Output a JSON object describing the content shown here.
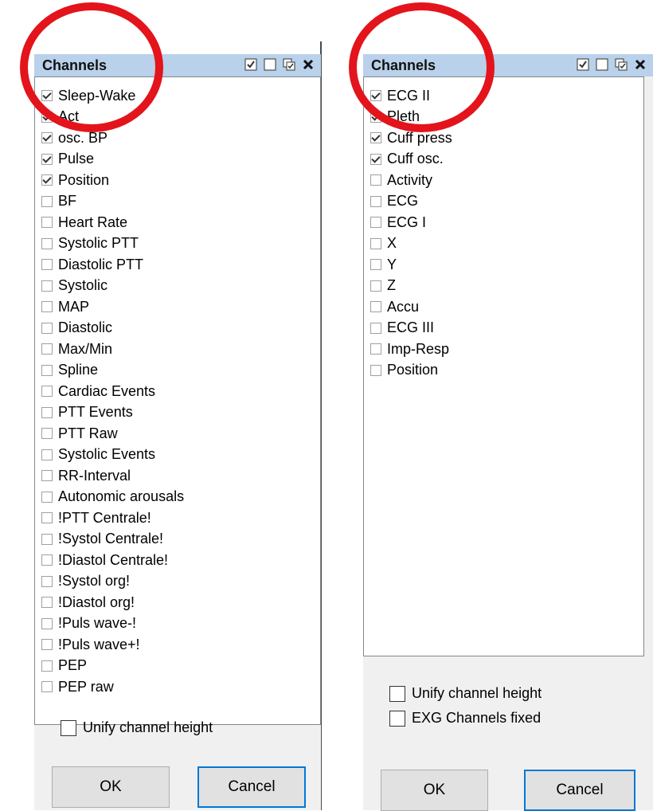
{
  "left_dialog": {
    "title": "Channels",
    "items": [
      {
        "label": "Sleep-Wake",
        "checked": true
      },
      {
        "label": "Act",
        "checked": true
      },
      {
        "label": "osc. BP",
        "checked": true
      },
      {
        "label": "Pulse",
        "checked": true
      },
      {
        "label": "Position",
        "checked": true
      },
      {
        "label": "BF",
        "checked": false
      },
      {
        "label": "Heart Rate",
        "checked": false
      },
      {
        "label": "Systolic PTT",
        "checked": false
      },
      {
        "label": "Diastolic PTT",
        "checked": false
      },
      {
        "label": "Systolic",
        "checked": false
      },
      {
        "label": "MAP",
        "checked": false
      },
      {
        "label": "Diastolic",
        "checked": false
      },
      {
        "label": "Max/Min",
        "checked": false
      },
      {
        "label": "Spline",
        "checked": false
      },
      {
        "label": "Cardiac Events",
        "checked": false
      },
      {
        "label": "PTT Events",
        "checked": false
      },
      {
        "label": "PTT Raw",
        "checked": false
      },
      {
        "label": "Systolic Events",
        "checked": false
      },
      {
        "label": "RR-Interval",
        "checked": false
      },
      {
        "label": "Autonomic arousals",
        "checked": false
      },
      {
        "label": "!PTT Centrale!",
        "checked": false
      },
      {
        "label": "!Systol Centrale!",
        "checked": false
      },
      {
        "label": "!Diastol Centrale!",
        "checked": false
      },
      {
        "label": "!Systol org!",
        "checked": false
      },
      {
        "label": "!Diastol org!",
        "checked": false
      },
      {
        "label": "!Puls wave-!",
        "checked": false
      },
      {
        "label": "!Puls wave+!",
        "checked": false
      },
      {
        "label": "PEP",
        "checked": false
      },
      {
        "label": "PEP raw",
        "checked": false
      }
    ],
    "unify_label": "Unify channel height",
    "ok_label": "OK",
    "cancel_label": "Cancel"
  },
  "right_dialog": {
    "title": "Channels",
    "items": [
      {
        "label": "ECG II",
        "checked": true
      },
      {
        "label": "Pleth",
        "checked": true
      },
      {
        "label": "Cuff press",
        "checked": true
      },
      {
        "label": "Cuff osc.",
        "checked": true
      },
      {
        "label": "Activity",
        "checked": false
      },
      {
        "label": "ECG",
        "checked": false
      },
      {
        "label": "ECG I",
        "checked": false
      },
      {
        "label": "X",
        "checked": false
      },
      {
        "label": "Y",
        "checked": false
      },
      {
        "label": "Z",
        "checked": false
      },
      {
        "label": "Accu",
        "checked": false
      },
      {
        "label": "ECG III",
        "checked": false
      },
      {
        "label": "Imp-Resp",
        "checked": false
      },
      {
        "label": "Position",
        "checked": false
      }
    ],
    "unify_label": "Unify channel height",
    "exg_label": "EXG Channels fixed",
    "ok_label": "OK",
    "cancel_label": "Cancel"
  },
  "colors": {
    "titlebar": "#b9d1ea",
    "highlight_ring": "#e3141b",
    "primary_border": "#0078d7"
  },
  "icons": [
    "check-all-icon",
    "uncheck-all-icon",
    "toggle-icon",
    "close-icon"
  ]
}
